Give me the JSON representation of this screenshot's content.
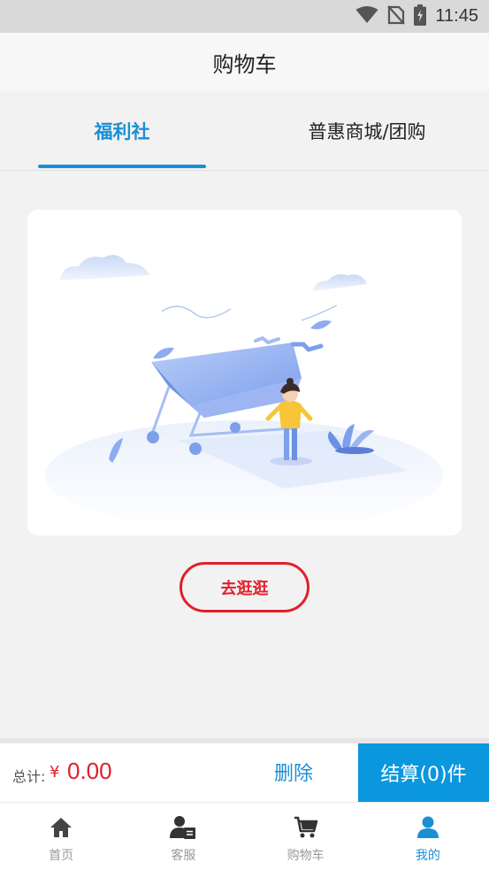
{
  "status_bar": {
    "time": "11:45",
    "icons": [
      "wifi-icon",
      "no-sim-icon",
      "battery-charging-icon"
    ]
  },
  "header": {
    "title": "购物车"
  },
  "tabs": [
    {
      "label": "福利社",
      "active": true
    },
    {
      "label": "普惠商城/团购",
      "active": false
    }
  ],
  "empty_state": {
    "illustration": "empty-shopping-cart-illustration",
    "button_label": "去逛逛"
  },
  "checkout_bar": {
    "total_label": "总计:",
    "currency": "¥",
    "total_amount": "0.00",
    "delete_label": "删除",
    "checkout_label": "结算(0)件"
  },
  "tabbar": {
    "items": [
      {
        "label": "首页",
        "icon": "home-icon",
        "active": false
      },
      {
        "label": "客服",
        "icon": "customer-service-icon",
        "active": false
      },
      {
        "label": "购物车",
        "icon": "cart-icon",
        "active": false
      },
      {
        "label": "我的",
        "icon": "profile-icon",
        "active": true
      }
    ]
  },
  "colors": {
    "accent": "#1a8fd3",
    "checkout_button": "#0b97de",
    "price": "#e0202a",
    "inactive_text": "#999999"
  }
}
